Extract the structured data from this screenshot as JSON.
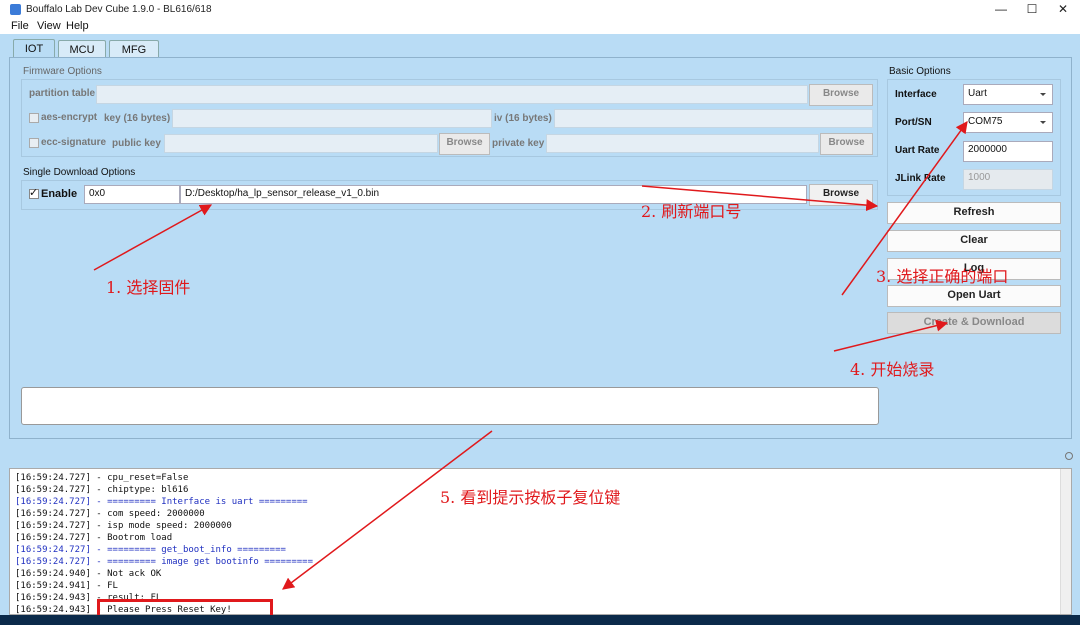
{
  "window": {
    "title": "Bouffalo Lab Dev Cube 1.9.0 - BL616/618",
    "controls": [
      "—",
      "☐",
      "✕"
    ]
  },
  "menu": [
    "File",
    "View",
    "Help"
  ],
  "tabs": [
    "IOT",
    "MCU",
    "MFG"
  ],
  "firmware_options": {
    "title": "Firmware Options",
    "partition_table_label": "partition table",
    "aes_encrypt_label": "aes-encrypt",
    "key_label": "key (16 bytes)",
    "iv_label": "iv (16 bytes)",
    "ecc_signature_label": "ecc-signature",
    "public_key_label": "public key",
    "private_key_label": "private key",
    "browse": "Browse"
  },
  "single_download": {
    "title": "Single Download Options",
    "enable_label": "Enable",
    "checkmark": "✓",
    "address": "0x0",
    "path": "D:/Desktop/ha_lp_sensor_release_v1_0.bin",
    "browse": "Browse"
  },
  "basic_options": {
    "title": "Basic Options",
    "interface_label": "Interface",
    "interface_value": "Uart",
    "port_label": "Port/SN",
    "port_value": "COM75",
    "uart_rate_label": "Uart Rate",
    "uart_rate_value": "2000000",
    "jlink_rate_label": "JLink Rate",
    "jlink_rate_value": "1000"
  },
  "actions": {
    "refresh": "Refresh",
    "clear": "Clear",
    "log": "Log",
    "open_uart": "Open Uart",
    "create_download": "Create & Download"
  },
  "annotations": {
    "step1": "1. 选择固件",
    "step2": "2. 刷新端口号",
    "step3": "3. 选择正确的端口",
    "step4": "4. 开始烧录",
    "step5": "5. 看到提示按板子复位键"
  },
  "log_lines": [
    {
      "text": "[16:59:24.727] - cpu_reset=False",
      "color": "black"
    },
    {
      "text": "[16:59:24.727] - chiptype: bl616",
      "color": "black"
    },
    {
      "text": "[16:59:24.727] - ========= Interface is uart =========",
      "color": "blue"
    },
    {
      "text": "[16:59:24.727] - com speed: 2000000",
      "color": "black"
    },
    {
      "text": "[16:59:24.727] - isp mode speed: 2000000",
      "color": "black"
    },
    {
      "text": "[16:59:24.727] - Bootrom load",
      "color": "black"
    },
    {
      "text": "[16:59:24.727] - ========= get_boot_info =========",
      "color": "blue"
    },
    {
      "text": "[16:59:24.727] - ========= image get bootinfo =========",
      "color": "blue"
    },
    {
      "text": "[16:59:24.940] - Not ack OK",
      "color": "black"
    },
    {
      "text": "[16:59:24.941] - FL",
      "color": "black"
    },
    {
      "text": "[16:59:24.943] - result: FL",
      "color": "black"
    },
    {
      "text": "[16:59:24.943] - Please Press Reset Key!",
      "color": "black"
    }
  ],
  "colors": {
    "annotation_red": "#e0191c",
    "log_blue": "#2030c0",
    "panel_bg": "#b9dcf5"
  }
}
